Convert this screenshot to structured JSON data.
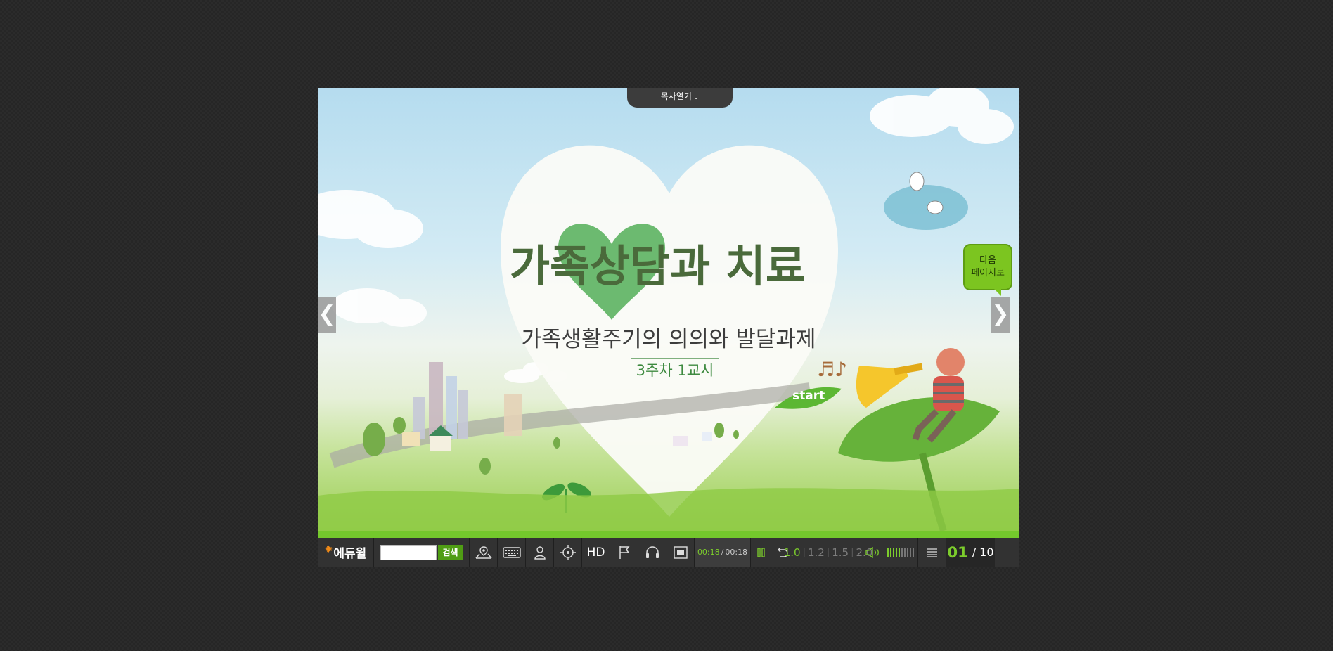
{
  "toc": {
    "label": "목차열기"
  },
  "slide": {
    "title": "가족상담과 치료",
    "subtitle": "가족생활주기의 의의와 발달과제",
    "session": "3주차 1교시",
    "start_label": "start",
    "next_bubble": [
      "다음",
      "페이지로"
    ]
  },
  "nav": {
    "prev": "❮",
    "next": "❯"
  },
  "progress": {
    "fraction": 1.0
  },
  "controlbar": {
    "logo": "에듀윌",
    "search_placeholder": "",
    "search_button": "검색",
    "hd": "HD",
    "time_current": "00:18",
    "time_sep": "/",
    "time_total": "00:18",
    "speeds": [
      "1.0",
      "1.2",
      "1.5",
      "2.0"
    ],
    "speed_active_index": 0,
    "volume_level": 5,
    "volume_max": 10,
    "page_current": "01",
    "page_total": "/ 10"
  },
  "colors": {
    "accent": "#7ccc2c",
    "bar": "#323232",
    "logo_sun": "#f08a18"
  }
}
